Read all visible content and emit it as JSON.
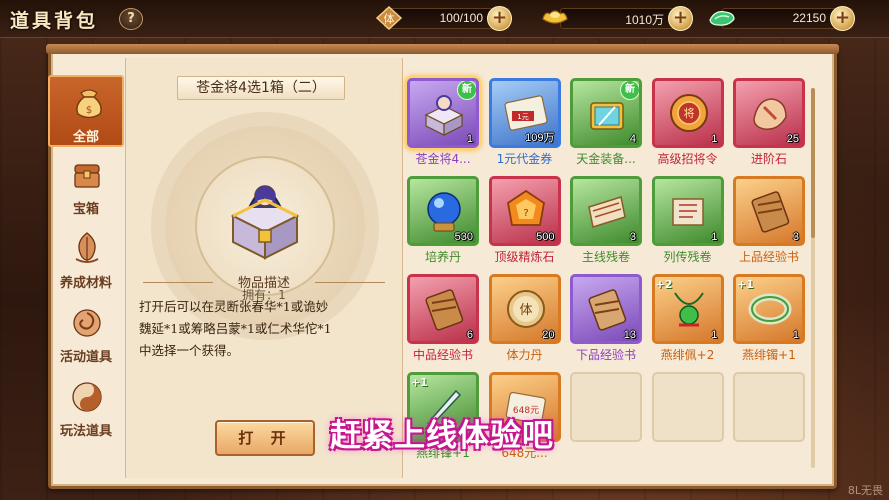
{
  "header": {
    "title": "道具背包",
    "help_icon": "?",
    "resources": [
      {
        "icon": "stamina-icon",
        "glyph": "体",
        "value": "100/100"
      },
      {
        "icon": "gold-ingot-icon",
        "value": "1010万"
      },
      {
        "icon": "jade-icon",
        "value": "22150"
      }
    ],
    "plus_label": "+"
  },
  "categories": [
    {
      "label": "全部",
      "icon": "pouch-icon",
      "active": true
    },
    {
      "label": "宝箱",
      "icon": "chest-icon",
      "active": false
    },
    {
      "label": "养成材料",
      "icon": "leaf-icon",
      "active": false
    },
    {
      "label": "活动道具",
      "icon": "swirl-icon",
      "active": false
    },
    {
      "label": "玩法道具",
      "icon": "taiji-icon",
      "active": false
    }
  ],
  "detail": {
    "name": "苍金将4选1箱（二）",
    "owned": "拥有：1",
    "desc_title": "物品描述",
    "desc_lines": [
      "打开后可以在灵断张春华*1或诡妙",
      "魏延*1或筹略吕蒙*1或仁术华佗*1",
      "中选择一个获得。"
    ],
    "open_button": "打 开"
  },
  "items": [
    {
      "name": "苍金将4...",
      "count": "1",
      "quality": "purple",
      "tag": "新",
      "art": "chest"
    },
    {
      "name": "1元代金券",
      "count": "109万",
      "quality": "blue",
      "tag": "",
      "art": "coupon",
      "sub": "1元"
    },
    {
      "name": "天金装备...",
      "count": "4",
      "quality": "green",
      "tag": "新",
      "art": "gear-chest"
    },
    {
      "name": "高级招将令",
      "count": "1",
      "quality": "red",
      "tag": "",
      "art": "token",
      "sub": "将"
    },
    {
      "name": "进阶石",
      "count": "25",
      "quality": "red",
      "tag": "",
      "art": "stone"
    },
    {
      "name": "培养丹",
      "count": "530",
      "quality": "green",
      "tag": "",
      "art": "orb"
    },
    {
      "name": "顶级精炼石",
      "count": "500",
      "quality": "red",
      "tag": "",
      "art": "gem"
    },
    {
      "name": "主线残卷",
      "count": "3",
      "quality": "green",
      "tag": "",
      "art": "scroll"
    },
    {
      "name": "列传残卷",
      "count": "1",
      "quality": "green",
      "tag": "",
      "art": "scroll2"
    },
    {
      "name": "上品经验书",
      "count": "3",
      "quality": "orange",
      "tag": "",
      "art": "book"
    },
    {
      "name": "中品经验书",
      "count": "6",
      "quality": "red",
      "tag": "",
      "art": "book"
    },
    {
      "name": "体力丹",
      "count": "20",
      "quality": "orange",
      "tag": "",
      "art": "pill",
      "sub": "体"
    },
    {
      "name": "下品经验书",
      "count": "13",
      "quality": "purple",
      "tag": "",
      "art": "book2"
    },
    {
      "name": "燕绯佩+2",
      "count": "1",
      "quality": "orange",
      "tag": "+2",
      "art": "pendant"
    },
    {
      "name": "燕绯镯+1",
      "count": "1",
      "quality": "orange",
      "tag": "+1",
      "art": "bracelet"
    },
    {
      "name": "燕绯锋+1",
      "count": "",
      "quality": "green",
      "tag": "+1",
      "art": "blade"
    },
    {
      "name": "648元...",
      "count": "",
      "quality": "orange",
      "tag": "",
      "art": "coupon2",
      "sub": "648元"
    },
    {
      "name": "",
      "count": "",
      "quality": "empty",
      "tag": "",
      "art": "none"
    },
    {
      "name": "",
      "count": "",
      "quality": "empty",
      "tag": "",
      "art": "none"
    },
    {
      "name": "",
      "count": "",
      "quality": "empty",
      "tag": "",
      "art": "none"
    }
  ],
  "promo_text": "赶紧上线体验吧",
  "watermark": "8L无畏"
}
